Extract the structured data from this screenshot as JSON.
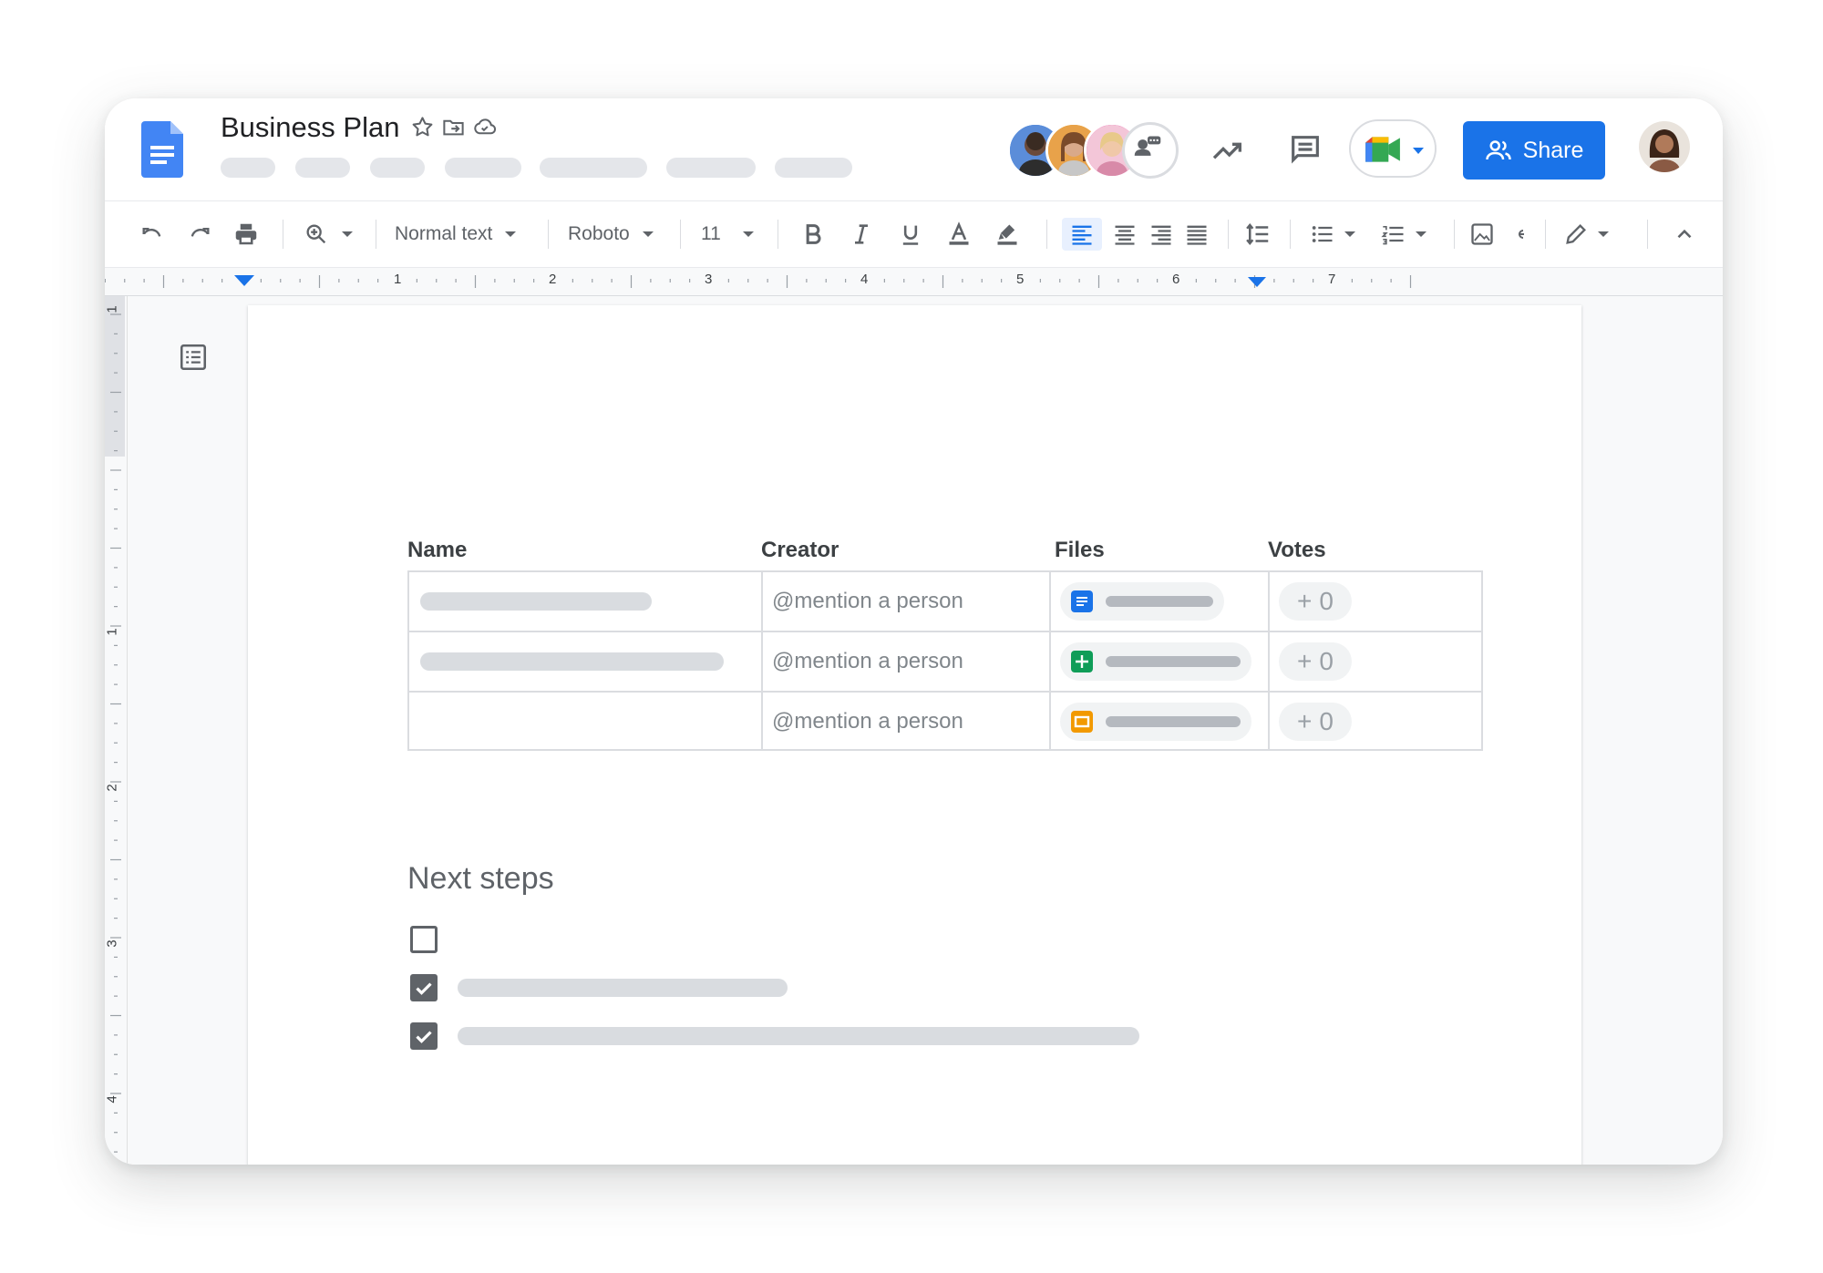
{
  "doc": {
    "title": "Business Plan",
    "menu_items": [
      "",
      "",
      "",
      "",
      "",
      "",
      "",
      ""
    ]
  },
  "header": {
    "share_label": "Share",
    "collaborator_count": 4
  },
  "toolbar": {
    "style_label": "Normal text",
    "font_label": "Roboto",
    "size_label": "11"
  },
  "ruler": {
    "marks": [
      "1",
      "2",
      "3",
      "4",
      "5",
      "6",
      "7"
    ],
    "vertical_marks": [
      "1",
      "1",
      "2",
      "3",
      "4"
    ]
  },
  "table": {
    "headers": {
      "name": "Name",
      "creator": "Creator",
      "files": "Files",
      "votes": "Votes"
    },
    "rows": [
      {
        "creator": "@mention a person",
        "file_type": "docs",
        "vote_plus": "+",
        "votes": "0"
      },
      {
        "creator": "@mention a person",
        "file_type": "sheets",
        "vote_plus": "+",
        "votes": "0"
      },
      {
        "creator": "@mention a person",
        "file_type": "slides",
        "vote_plus": "+",
        "votes": "0"
      }
    ]
  },
  "next_steps": {
    "heading": "Next steps",
    "items": [
      {
        "checked": false
      },
      {
        "checked": true
      },
      {
        "checked": true
      }
    ]
  },
  "colors": {
    "accent": "#1a73e8",
    "docs_blue": "#4285f4",
    "sheets_green": "#0f9d58",
    "slides_orange": "#f29900",
    "placeholder_grey": "#d9dce0"
  }
}
